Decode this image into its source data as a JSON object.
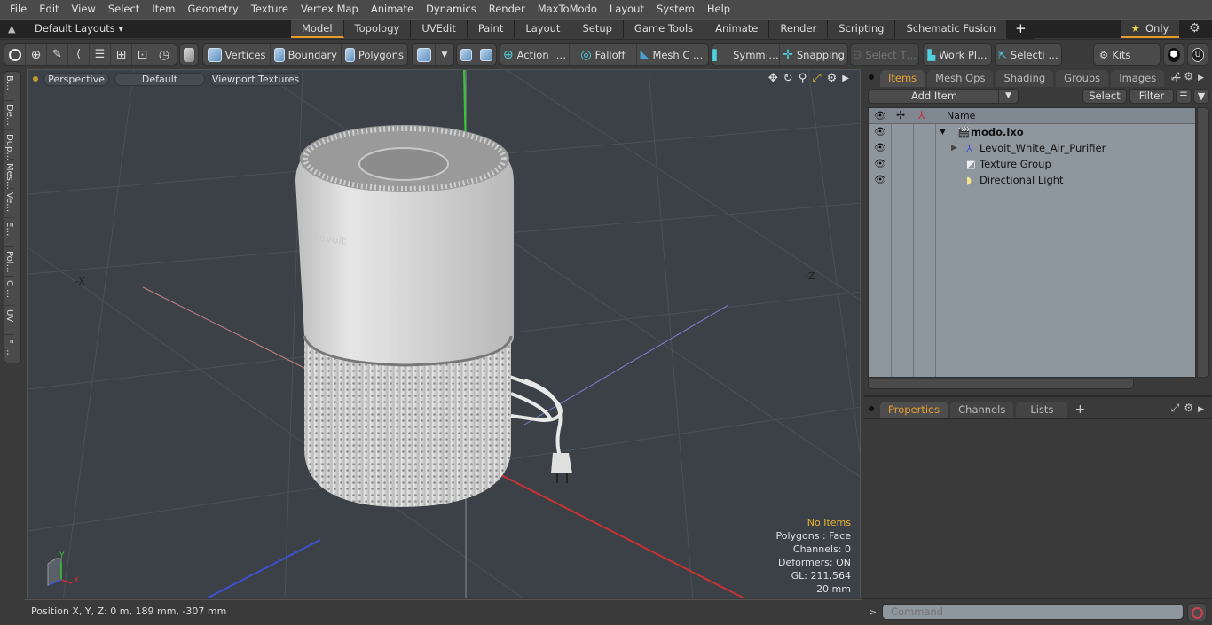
{
  "menu": [
    "File",
    "Edit",
    "View",
    "Select",
    "Item",
    "Geometry",
    "Texture",
    "Vertex Map",
    "Animate",
    "Dynamics",
    "Render",
    "MaxToModo",
    "Layout",
    "System",
    "Help"
  ],
  "layout_selector": "Default Layouts ▾",
  "layout_tabs": [
    {
      "label": "Model",
      "active": true
    },
    {
      "label": "Topology"
    },
    {
      "label": "UVEdit"
    },
    {
      "label": "Paint"
    },
    {
      "label": "Layout"
    },
    {
      "label": "Setup"
    },
    {
      "label": "Game Tools"
    },
    {
      "label": "Animate"
    },
    {
      "label": "Render"
    },
    {
      "label": "Scripting"
    },
    {
      "label": "Schematic Fusion"
    }
  ],
  "layout_add": "+",
  "only_label": "Only",
  "toolbar": {
    "vertices": "Vertices",
    "boundary": "Boundary",
    "polygons": "Polygons",
    "action": "Action",
    "action_more": "…",
    "falloff": "Falloff",
    "mesh": "Mesh C …",
    "symm": "Symm …",
    "snapping": "Snapping",
    "select_t": "Select T…",
    "workplane": "Work Pl…",
    "selection": "Selecti …",
    "kits": "Kits"
  },
  "left_tools": [
    "B…",
    "De…",
    "Dup…",
    "Mes…",
    "Ve…",
    "E…",
    "Pol…",
    "C …",
    "UV",
    "F …"
  ],
  "viewport": {
    "view": "Perspective",
    "shading": "Default",
    "textures": "Viewport Textures",
    "axis_x": "-X",
    "axis_z": "-Z",
    "gizmo_x": "X",
    "gizmo_y": "Y",
    "info": {
      "selection": "No Items",
      "polygons": "Polygons : Face",
      "channels": "Channels: 0",
      "deformers": "Deformers: ON",
      "gl": "GL: 211,564",
      "scale": "20 mm"
    }
  },
  "status": "Position X, Y, Z:   0 m, 189 mm, -307 mm",
  "items_panel": {
    "tabs": [
      {
        "label": "Items",
        "active": true
      },
      {
        "label": "Mesh Ops"
      },
      {
        "label": "Shading"
      },
      {
        "label": "Groups"
      },
      {
        "label": "Images"
      }
    ],
    "add_item": "Add Item",
    "select": "Select",
    "filter": "Filter",
    "name_header": "Name",
    "rows": [
      {
        "name": "modo.lxo",
        "bold": true,
        "level": 0
      },
      {
        "name": "Levoit_White_Air_Purifier",
        "level": 1
      },
      {
        "name": "Texture Group",
        "level": 1
      },
      {
        "name": "Directional Light",
        "level": 1
      }
    ]
  },
  "props_panel": {
    "tabs": [
      {
        "label": "Properties",
        "active": true
      },
      {
        "label": "Channels"
      },
      {
        "label": "Lists"
      }
    ]
  },
  "command_placeholder": "Command",
  "colors": {
    "accent": "#e69a28",
    "x_axis": "#c83232",
    "y_axis": "#32c832",
    "z_axis": "#3c50d0"
  }
}
